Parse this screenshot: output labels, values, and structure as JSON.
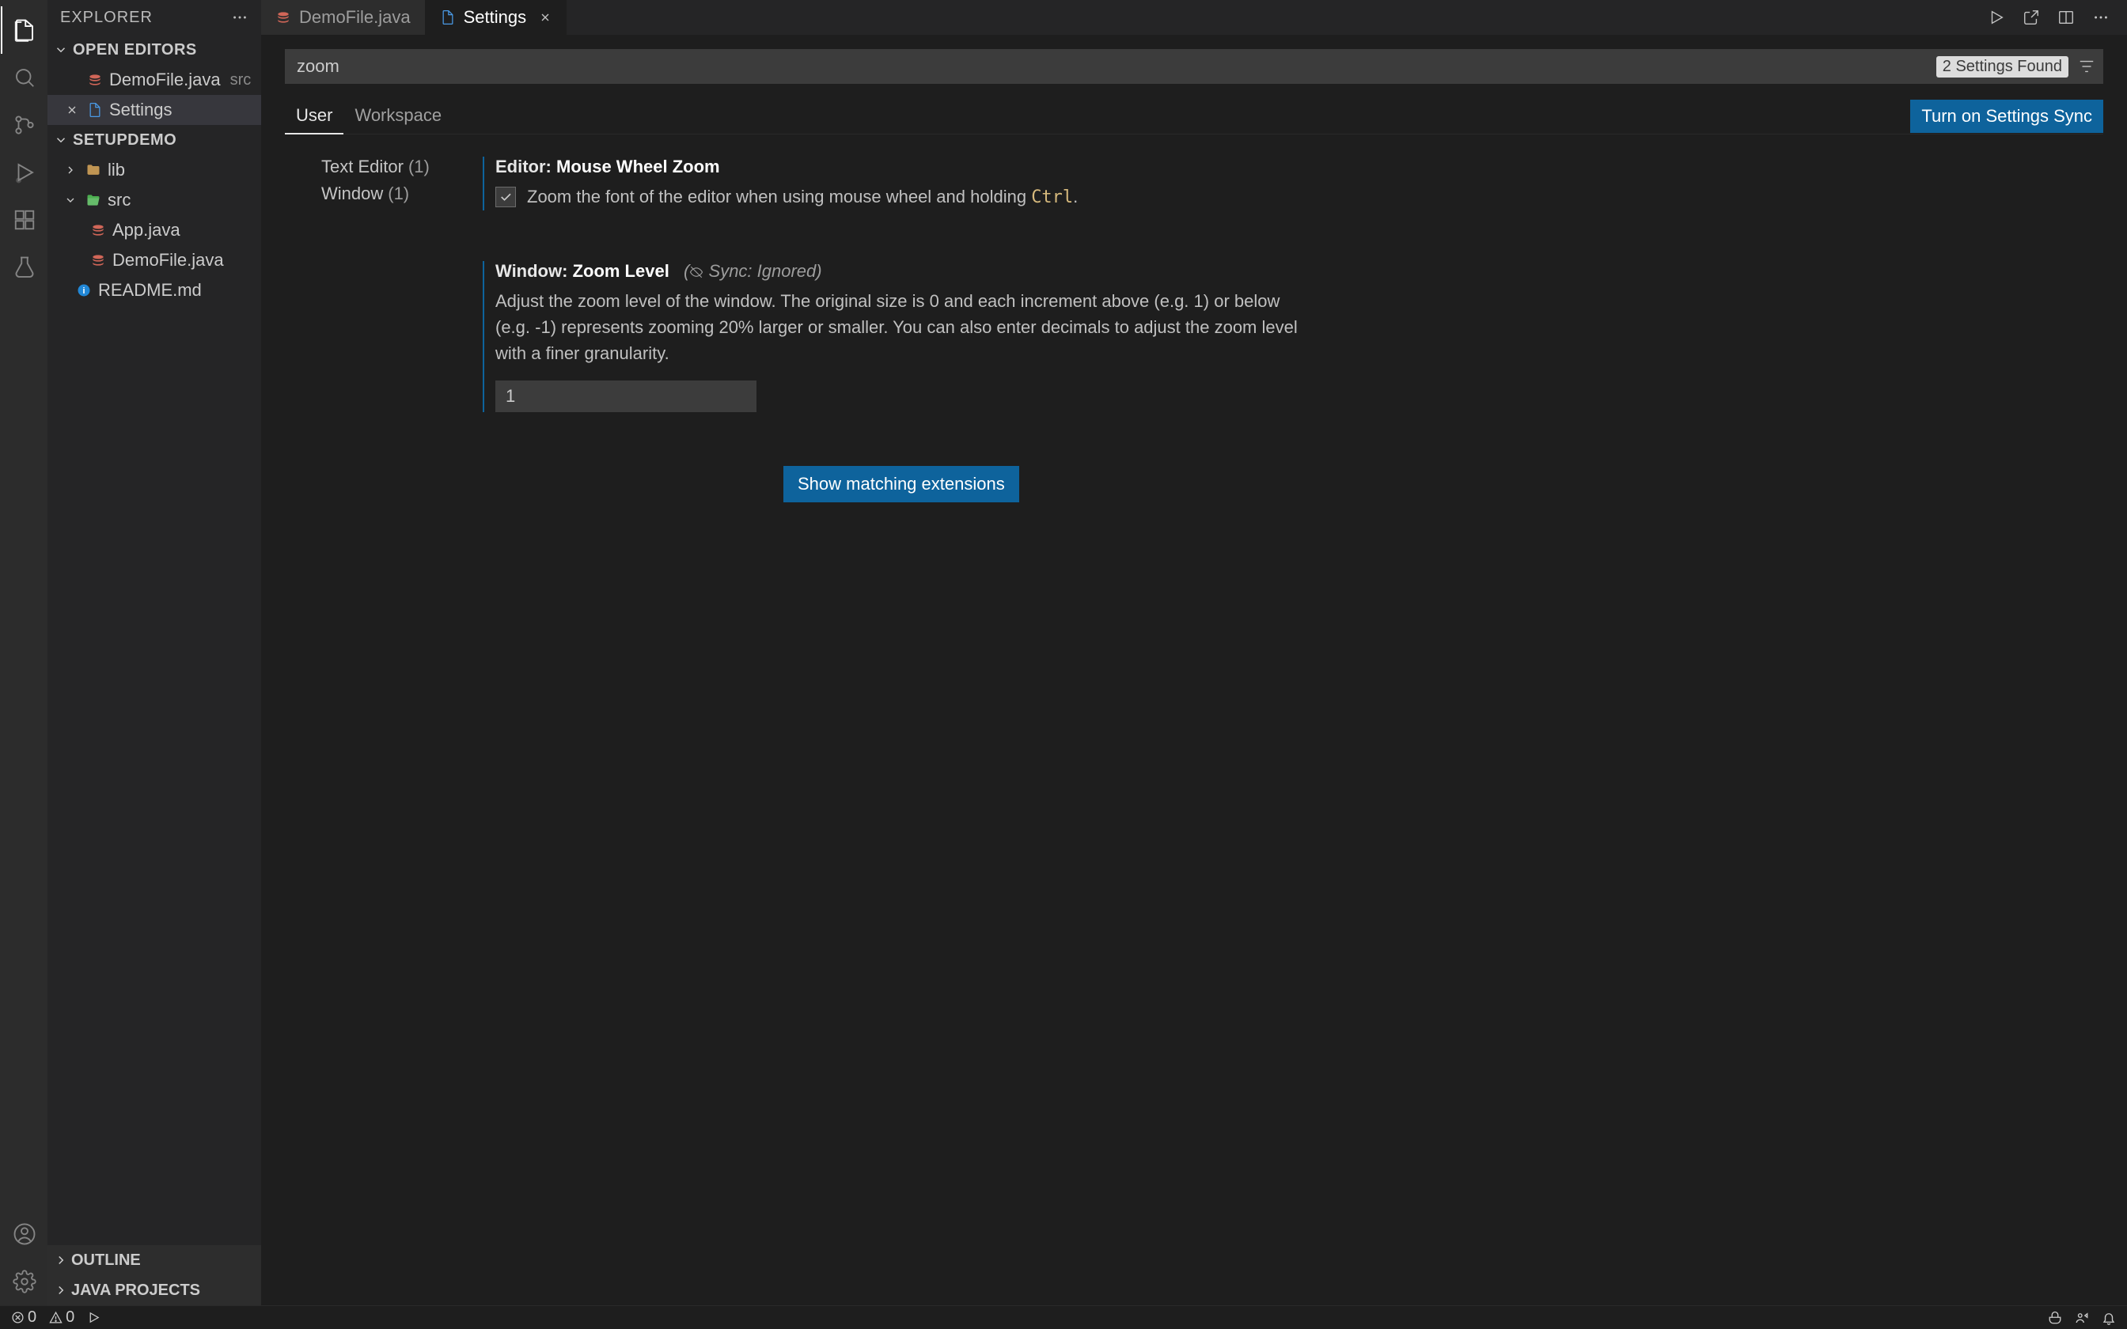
{
  "sidebar": {
    "title": "EXPLORER",
    "open_editors_label": "OPEN EDITORS",
    "open_editors": [
      {
        "name": "DemoFile.java",
        "desc": "src",
        "icon": "java"
      },
      {
        "name": "Settings",
        "desc": "",
        "icon": "settings"
      }
    ],
    "workspace_label": "SETUPDEMO",
    "tree": {
      "lib": "lib",
      "src": "src",
      "app": "App.java",
      "demo": "DemoFile.java",
      "readme": "README.md"
    },
    "outline_label": "OUTLINE",
    "java_projects_label": "JAVA PROJECTS"
  },
  "tabs": [
    {
      "label": "DemoFile.java",
      "icon": "java",
      "active": false
    },
    {
      "label": "Settings",
      "icon": "settings",
      "active": true
    }
  ],
  "settings": {
    "search_value": "zoom",
    "found_badge": "2 Settings Found",
    "scopes": {
      "user": "User",
      "workspace": "Workspace"
    },
    "sync_button": "Turn on Settings Sync",
    "nav": {
      "text_editor": "Text Editor",
      "text_editor_count": "(1)",
      "window": "Window",
      "window_count": "(1)"
    },
    "items": {
      "mwz": {
        "scope": "Editor:",
        "name": "Mouse Wheel Zoom",
        "desc_pre": "Zoom the font of the editor when using mouse wheel and holding ",
        "desc_kbd": "Ctrl",
        "desc_post": "."
      },
      "wzl": {
        "scope": "Window:",
        "name": "Zoom Level",
        "sync_note": "Sync: Ignored)",
        "desc": "Adjust the zoom level of the window. The original size is 0 and each increment above (e.g. 1) or below (e.g. -1) represents zooming 20% larger or smaller. You can also enter decimals to adjust the zoom level with a finer granularity.",
        "value": "1"
      }
    },
    "show_extensions": "Show matching extensions"
  },
  "status": {
    "errors": "0",
    "warnings": "0"
  }
}
